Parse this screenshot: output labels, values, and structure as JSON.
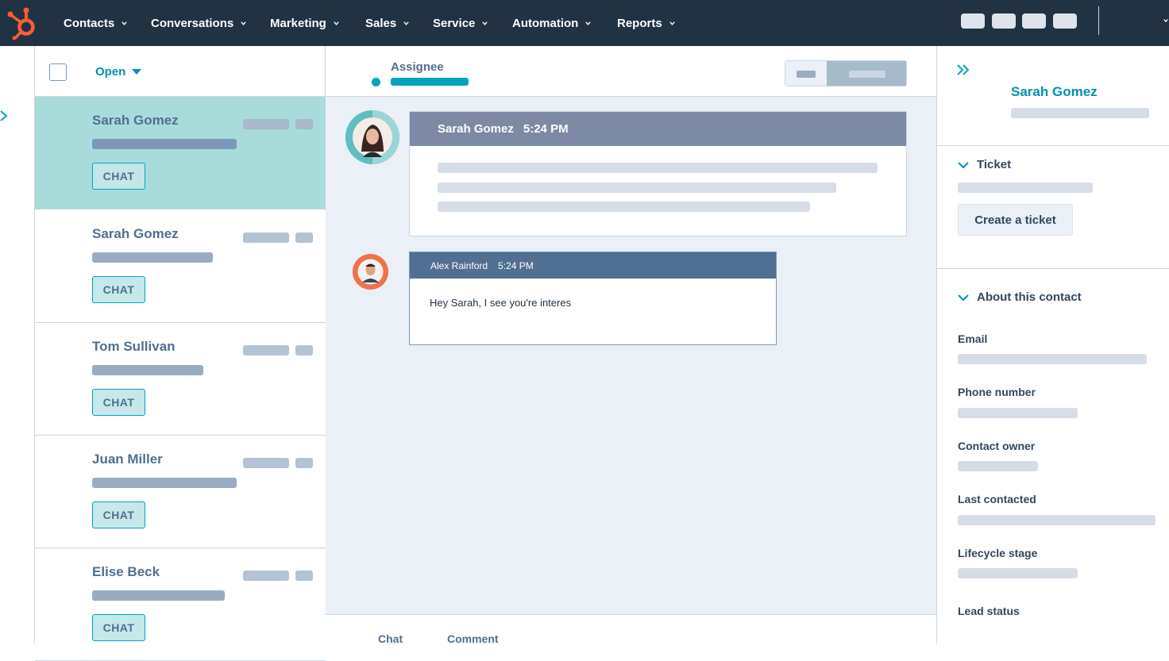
{
  "nav": {
    "items": [
      {
        "label": "Contacts"
      },
      {
        "label": "Conversations"
      },
      {
        "label": "Marketing"
      },
      {
        "label": "Sales"
      },
      {
        "label": "Service"
      },
      {
        "label": "Automation"
      },
      {
        "label": "Reports"
      }
    ]
  },
  "inbox": {
    "filter_label": "Open",
    "conversations": [
      {
        "name": "Sarah Gomez",
        "channel": "CHAT",
        "selected": true
      },
      {
        "name": "Sarah Gomez",
        "channel": "CHAT",
        "selected": false
      },
      {
        "name": "Tom Sullivan",
        "channel": "CHAT",
        "selected": false
      },
      {
        "name": "Juan Miller",
        "channel": "CHAT",
        "selected": false
      },
      {
        "name": "Elise Beck",
        "channel": "CHAT",
        "selected": false
      }
    ]
  },
  "thread": {
    "assignee_label": "Assignee",
    "messages": [
      {
        "sender": "Sarah Gomez",
        "time": "5:24 PM"
      },
      {
        "sender": "Alex Rainford",
        "time": "5:24 PM",
        "body": "Hey Sarah, I see you're interes"
      }
    ],
    "composer_tabs": [
      "Chat",
      "Comment"
    ]
  },
  "contact": {
    "name": "Sarah Gomez",
    "ticket_section": "Ticket",
    "create_ticket_label": "Create a ticket",
    "about_section": "About this contact",
    "fields": [
      "Email",
      "Phone number",
      "Contact owner",
      "Last contacted",
      "Lifecycle stage",
      "Lead status"
    ]
  },
  "colors": {
    "nav_bg": "#213343",
    "accent_teal": "#00a4bd",
    "selected_row": "#a8dcdb",
    "brand_orange": "#ff5c35"
  }
}
